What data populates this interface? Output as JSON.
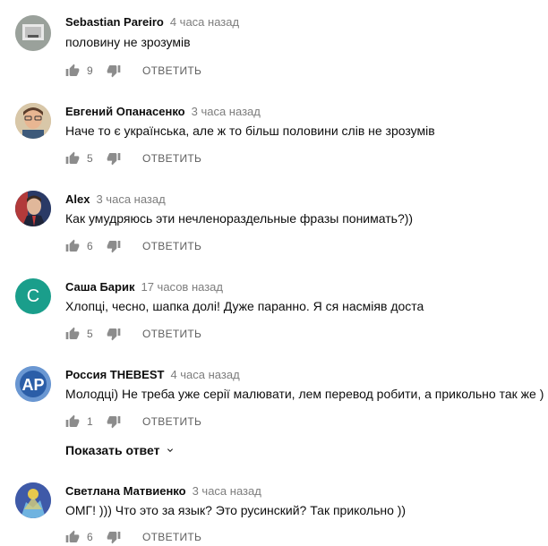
{
  "comments": [
    {
      "author": "Sebastian Pareiro",
      "time": "4 часа назад",
      "text": "половину не зрозумів",
      "likes": "9",
      "reply": "ОТВЕТИТЬ",
      "avatar": "photo"
    },
    {
      "author": "Евгений Опанасенко",
      "time": "3 часа назад",
      "text": "Наче то є українська, але ж то більш половини слів не зрозумів",
      "likes": "5",
      "reply": "ОТВЕТИТЬ",
      "avatar": "photo"
    },
    {
      "author": "Alex",
      "time": "3 часа назад",
      "text": "Как умудряюсь эти нечленораздельные фразы понимать?))",
      "likes": "6",
      "reply": "ОТВЕТИТЬ",
      "avatar": "photo"
    },
    {
      "author": "Саша Барик",
      "time": "17 часов назад",
      "text": "Хлопці,  чесно,  шапка долі!  Дуже параннo.  Я ся насміяв доста",
      "likes": "5",
      "reply": "ОТВЕТИТЬ",
      "avatar": "C",
      "avatar_color": "#1a9e8b"
    },
    {
      "author": "Россия THEBEST",
      "time": "4 часа назад",
      "text": "Молодці) Не треба уже серії малювати, лем перевод робити, а прикольно так же )",
      "likes": "1",
      "reply": "ОТВЕТИТЬ",
      "avatar": "AP"
    },
    {
      "author": "Светлана Матвиенко",
      "time": "3 часа назад",
      "text": "ОМГ! )))  Что это за язык? Это русинский? Так прикольно ))",
      "likes": "6",
      "reply": "ОТВЕТИТЬ",
      "avatar": "photo"
    }
  ],
  "show_reply_label": "Показать ответ"
}
